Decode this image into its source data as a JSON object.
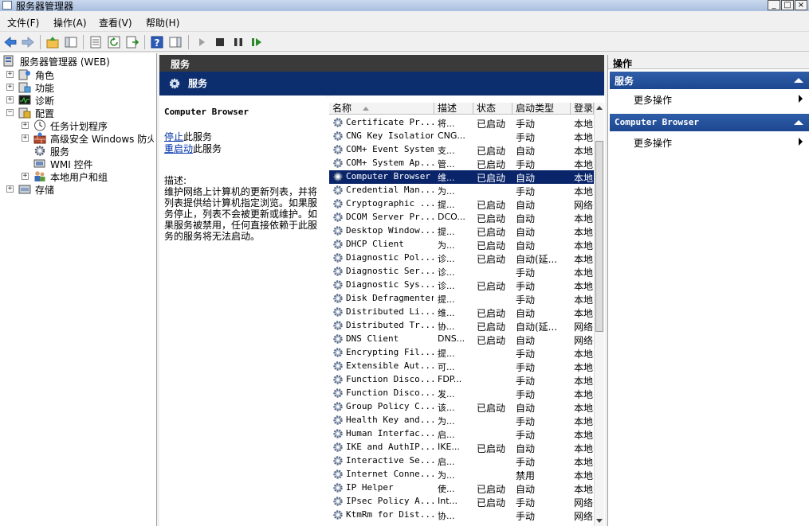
{
  "window": {
    "title": "服务器管理器",
    "controls": [
      "_",
      "□",
      "×"
    ]
  },
  "menu": [
    "文件(F)",
    "操作(A)",
    "查看(V)",
    "帮助(H)"
  ],
  "tree": {
    "root": "服务器管理器 (WEB)",
    "items": [
      {
        "label": "角色",
        "icon": "roles-icon"
      },
      {
        "label": "功能",
        "icon": "features-icon"
      },
      {
        "label": "诊断",
        "icon": "diagnostics-icon"
      },
      {
        "label": "配置",
        "icon": "configuration-icon"
      },
      {
        "label": "任务计划程序",
        "icon": "clock-icon"
      },
      {
        "label": "高级安全 Windows 防火墙",
        "icon": "firewall-icon"
      },
      {
        "label": "服务",
        "icon": "gear-icon"
      },
      {
        "label": "WMI 控件",
        "icon": "wmi-icon"
      },
      {
        "label": "本地用户和组",
        "icon": "users-icon"
      },
      {
        "label": "存储",
        "icon": "storage-icon"
      }
    ]
  },
  "main": {
    "header": "服务",
    "banner": "服务",
    "selected_service": "Computer Browser",
    "stop_link": "停止",
    "stop_text": "此服务",
    "restart_link": "重启动",
    "restart_text": "此服务",
    "desc_label": "描述:",
    "desc_text": "维护网络上计算机的更新列表，并将列表提供给计算机指定浏览。如果服务停止，列表不会被更新或维护。如果服务被禁用，任何直接依赖于此服务的服务将无法启动。"
  },
  "grid": {
    "columns": [
      "名称",
      "描述",
      "状态",
      "启动类型",
      "登录为"
    ],
    "rows": [
      [
        "Certificate Pr...",
        "将...",
        "已启动",
        "手动",
        "本地"
      ],
      [
        "CNG Key Isolation",
        "CNG...",
        "",
        "手动",
        "本地"
      ],
      [
        "COM+ Event System",
        "支...",
        "已启动",
        "自动",
        "本地"
      ],
      [
        "COM+ System Ap...",
        "管...",
        "已启动",
        "手动",
        "本地"
      ],
      [
        "Computer Browser",
        "维...",
        "已启动",
        "自动",
        "本地"
      ],
      [
        "Credential Man...",
        "为...",
        "",
        "手动",
        "本地"
      ],
      [
        "Cryptographic ...",
        "提...",
        "已启动",
        "自动",
        "网络"
      ],
      [
        "DCOM Server Pr...",
        "DCO...",
        "已启动",
        "自动",
        "本地"
      ],
      [
        "Desktop Window...",
        "提...",
        "已启动",
        "自动",
        "本地"
      ],
      [
        "DHCP Client",
        "为...",
        "已启动",
        "自动",
        "本地"
      ],
      [
        "Diagnostic Pol...",
        "诊...",
        "已启动",
        "自动(延...",
        "本地"
      ],
      [
        "Diagnostic Ser...",
        "诊...",
        "",
        "手动",
        "本地"
      ],
      [
        "Diagnostic Sys...",
        "诊...",
        "已启动",
        "手动",
        "本地"
      ],
      [
        "Disk Defragmenter",
        "提...",
        "",
        "手动",
        "本地"
      ],
      [
        "Distributed Li...",
        "维...",
        "已启动",
        "自动",
        "本地"
      ],
      [
        "Distributed Tr...",
        "协...",
        "已启动",
        "自动(延...",
        "网络"
      ],
      [
        "DNS Client",
        "DNS...",
        "已启动",
        "自动",
        "网络"
      ],
      [
        "Encrypting Fil...",
        "提...",
        "",
        "手动",
        "本地"
      ],
      [
        "Extensible Aut...",
        "可...",
        "",
        "手动",
        "本地"
      ],
      [
        "Function Disco...",
        "FDP...",
        "",
        "手动",
        "本地"
      ],
      [
        "Function Disco...",
        "发...",
        "",
        "手动",
        "本地"
      ],
      [
        "Group Policy C...",
        "该...",
        "已启动",
        "自动",
        "本地"
      ],
      [
        "Health Key and...",
        "为...",
        "",
        "手动",
        "本地"
      ],
      [
        "Human Interfac...",
        "启...",
        "",
        "手动",
        "本地"
      ],
      [
        "IKE and AuthIP...",
        "IKE...",
        "已启动",
        "自动",
        "本地"
      ],
      [
        "Interactive Se...",
        "启...",
        "",
        "手动",
        "本地"
      ],
      [
        "Internet Conne...",
        "为...",
        "",
        "禁用",
        "本地"
      ],
      [
        "IP Helper",
        "使...",
        "已启动",
        "自动",
        "本地"
      ],
      [
        "IPsec Policy A...",
        "Int...",
        "已启动",
        "手动",
        "网络"
      ],
      [
        "KtmRm for Dist...",
        "协...",
        "",
        "手动",
        "网络"
      ]
    ]
  },
  "actions": {
    "title": "操作",
    "section1": "服务",
    "section1_item": "更多操作",
    "section2": "Computer Browser",
    "section2_item": "更多操作"
  }
}
